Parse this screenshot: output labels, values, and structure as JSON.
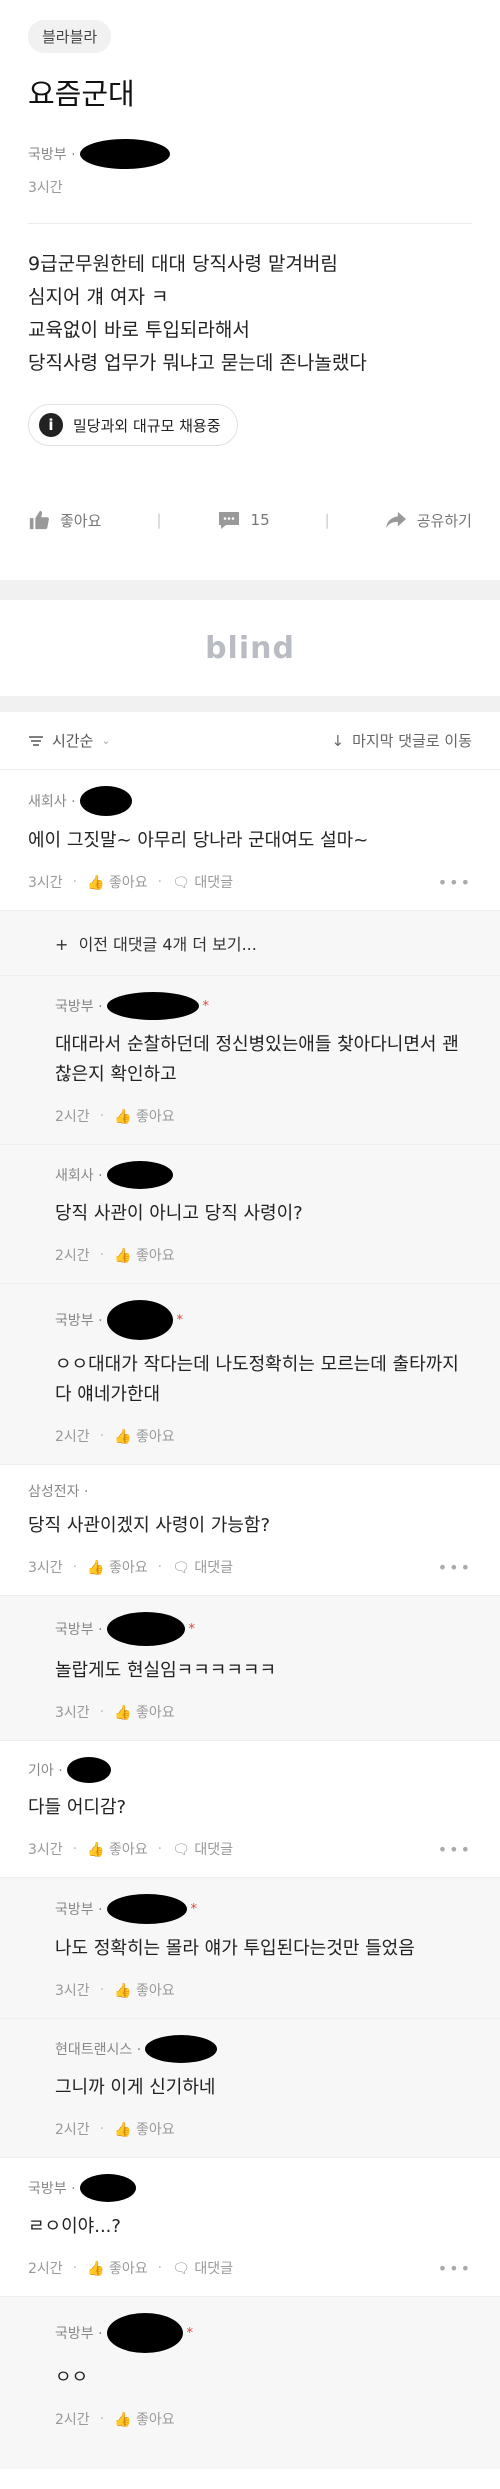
{
  "post": {
    "board": "블라블라",
    "title": "요즘군대",
    "company": "국방부 ·",
    "time": "3시간",
    "body": [
      "9급군무원한테 대대 당직사령 맡겨버림",
      "심지어 걔 여자 ㅋ",
      "교육없이 바로 투입되라해서",
      "당직사령 업무가 뭐냐고 묻는데 존나놀랬다"
    ],
    "ad_label": "밀당과외 대규모 채용중",
    "like_label": "좋아요",
    "comment_count": "15",
    "share_label": "공유하기"
  },
  "banner": {
    "logo": "blind"
  },
  "sort": {
    "order_label": "시간순",
    "jump_label": "마지막 댓글로 이동"
  },
  "load_more_label": "이전 대댓글 4개 더 보기...",
  "comments": [
    {
      "company": "새회사 ·",
      "text": "에이 그짓말~ 아무리 당나라 군대여도 설마~",
      "time": "3시간",
      "like": "좋아요",
      "reply": "대댓글",
      "is_reply": false
    },
    {
      "company": "국방부 ·",
      "text": "대대라서 순찰하던데  정신병있는애들 찾아다니면서 괜찮은지 확인하고",
      "time": "2시간",
      "like": "좋아요",
      "is_reply": true,
      "author_mark": "*"
    },
    {
      "company": "새회사 ·",
      "text": "당직 사관이 아니고 당직 사령이?",
      "time": "2시간",
      "like": "좋아요",
      "is_reply": true
    },
    {
      "company": "국방부 ·",
      "text": "ㅇㅇ대대가 작다는데 나도정확히는 모르는데 출타까지 다 얘네가한대",
      "time": "2시간",
      "like": "좋아요",
      "is_reply": true,
      "author_mark": "*"
    },
    {
      "company": "삼성전자 ·",
      "text": "당직 사관이겠지 사령이 가능함?",
      "time": "3시간",
      "like": "좋아요",
      "reply": "대댓글",
      "is_reply": false
    },
    {
      "company": "국방부 ·",
      "text": "놀랍게도 현실임ㅋㅋㅋㅋㅋㅋ",
      "time": "3시간",
      "like": "좋아요",
      "is_reply": true,
      "author_mark": "*"
    },
    {
      "company": "기아 ·",
      "text": "다들 어디감?",
      "time": "3시간",
      "like": "좋아요",
      "reply": "대댓글",
      "is_reply": false
    },
    {
      "company": "국방부 ·",
      "text": "나도 정확히는 몰라 얘가 투입된다는것만 들었음",
      "time": "3시간",
      "like": "좋아요",
      "is_reply": true,
      "author_mark": "*"
    },
    {
      "company": "현대트랜시스 ·",
      "text": "그니까 이게 신기하네",
      "time": "2시간",
      "like": "좋아요",
      "is_reply": true
    },
    {
      "company": "국방부 ·",
      "text": "ㄹㅇ이야...?",
      "time": "2시간",
      "like": "좋아요",
      "reply": "대댓글",
      "is_reply": false
    },
    {
      "company": "국방부 ·",
      "text": "ㅇㅇ",
      "time": "2시간",
      "like": "좋아요",
      "is_reply": true,
      "author_mark": "*"
    }
  ]
}
